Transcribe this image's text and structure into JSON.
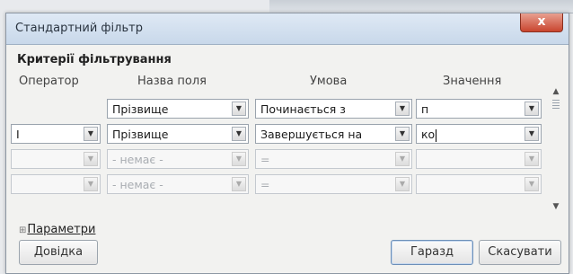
{
  "dialog": {
    "title": "Стандартний фільтр",
    "close_label": "x",
    "section_title": "Критерії фільтрування"
  },
  "headers": {
    "operator": "Оператор",
    "field": "Назва поля",
    "condition": "Умова",
    "value": "Значення"
  },
  "rows": [
    {
      "operator": "",
      "field": "Прізвище",
      "condition": "Починається з",
      "value": "п",
      "enabled": true
    },
    {
      "operator": "І",
      "field": "Прізвище",
      "condition": "Завершується на",
      "value": "ко",
      "enabled": true
    },
    {
      "operator": "",
      "field": "- немає -",
      "condition": "=",
      "value": "",
      "enabled": false
    },
    {
      "operator": "",
      "field": "- немає -",
      "condition": "=",
      "value": "",
      "enabled": false
    }
  ],
  "options_label": "Параметри",
  "buttons": {
    "help": "Довідка",
    "ok": "Гаразд",
    "cancel": "Скасувати"
  },
  "icons": {
    "dropdown": "chevron-down-icon",
    "close": "close-icon",
    "expand": "plus-icon"
  }
}
